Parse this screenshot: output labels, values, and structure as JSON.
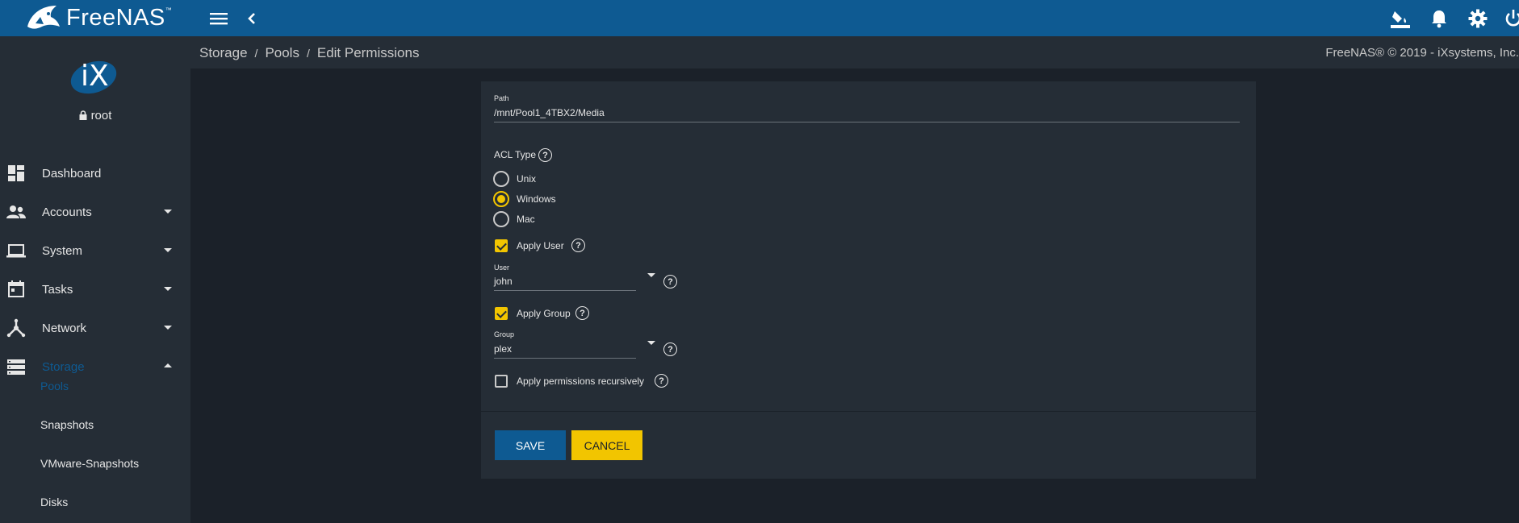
{
  "app": {
    "name": "FreeNAS",
    "tm": "™"
  },
  "topbar": {
    "icons": [
      "hamburger-menu-icon",
      "back-chevron-icon",
      "theme-paint-bucket-icon",
      "notification-bell-icon",
      "settings-gear-icon",
      "power-icon"
    ]
  },
  "sidebar": {
    "logo": "iX",
    "user": "root",
    "items": [
      {
        "label": "Dashboard",
        "icon": "dashboard-icon"
      },
      {
        "label": "Accounts",
        "icon": "accounts-icon"
      },
      {
        "label": "System",
        "icon": "laptop-icon"
      },
      {
        "label": "Tasks",
        "icon": "calendar-icon"
      },
      {
        "label": "Network",
        "icon": "network-icon"
      },
      {
        "label": "Storage",
        "icon": "storage-icon"
      }
    ],
    "subitems": [
      "Pools",
      "Snapshots",
      "VMware-Snapshots",
      "Disks"
    ]
  },
  "breadcrumb": [
    "Storage",
    "Pools",
    "Edit Permissions"
  ],
  "copyright": "FreeNAS® © 2019 - iXsystems, Inc.",
  "form": {
    "path_label": "Path",
    "path_value": "/mnt/Pool1_4TBX2/Media",
    "acl_type_label": "ACL Type",
    "acl_options": [
      "Unix",
      "Windows",
      "Mac"
    ],
    "acl_selected": "Windows",
    "apply_user_label": "Apply User",
    "apply_user_checked": true,
    "user_label": "User",
    "user_value": "john",
    "apply_group_label": "Apply Group",
    "apply_group_checked": true,
    "group_label": "Group",
    "group_value": "plex",
    "recursive_label": "Apply permissions recursively",
    "recursive_checked": false,
    "help_glyph": "?"
  },
  "buttons": {
    "save": "SAVE",
    "cancel": "CANCEL"
  },
  "colors": {
    "primary": "#0e5a92",
    "accent": "#f2c500",
    "background": "#1b2129",
    "panel": "#252d36"
  }
}
